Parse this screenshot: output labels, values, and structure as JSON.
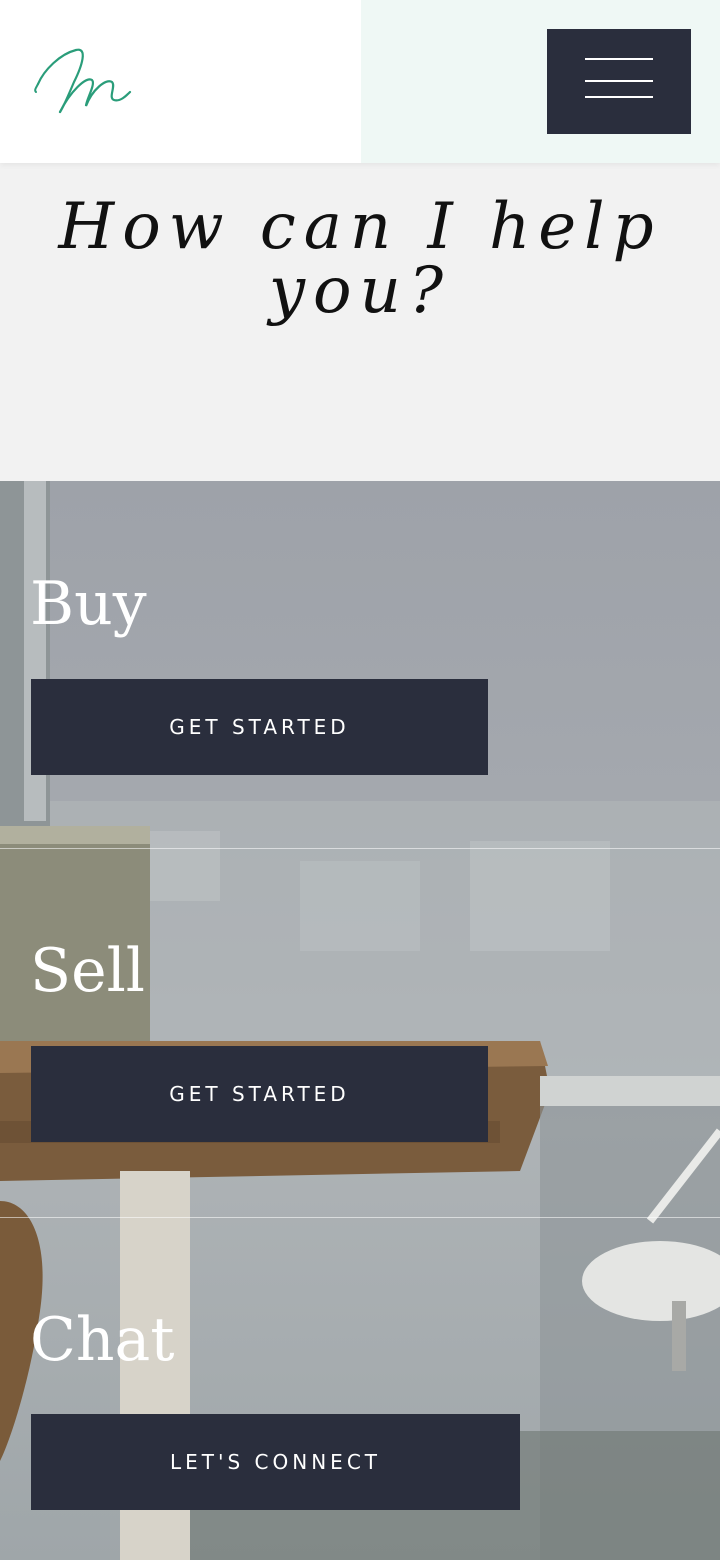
{
  "header": {
    "logo_icon": "script-m-logo-icon",
    "menu_icon": "hamburger-menu-icon",
    "brand_color": "#2a9d7a",
    "menu_bg": "#2a2e3d"
  },
  "hero": {
    "title": "How can I help you?"
  },
  "sections": [
    {
      "title": "Buy",
      "button_label": "GET STARTED"
    },
    {
      "title": "Sell",
      "button_label": "GET STARTED"
    },
    {
      "title": "Chat",
      "button_label": "LET'S CONNECT"
    }
  ]
}
